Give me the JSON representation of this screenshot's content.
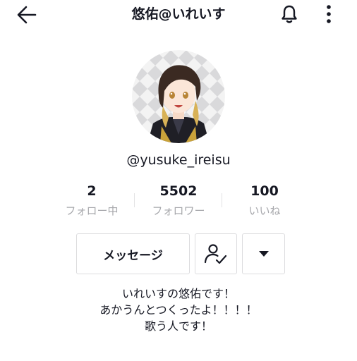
{
  "header": {
    "title": "悠佑@いれいす"
  },
  "profile": {
    "username": "@yusuke_ireisu"
  },
  "stats": [
    {
      "value": "2",
      "label": "フォロー中"
    },
    {
      "value": "5502",
      "label": "フォロワー"
    },
    {
      "value": "100",
      "label": "いいね"
    }
  ],
  "actions": {
    "message_label": "メッセージ"
  },
  "bio": {
    "lines": [
      "いれいすの悠佑です！",
      "あかうんとつくったよ！！！！",
      "歌う人です！"
    ]
  },
  "colors": {
    "text": "#161823",
    "secondary_text": "#a6a7ab",
    "border": "#dcdcde"
  }
}
